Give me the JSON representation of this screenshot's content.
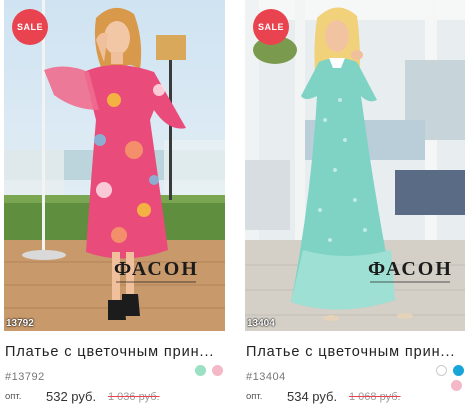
{
  "products": [
    {
      "sale_badge": "SALE",
      "watermark": "ФАСОН",
      "photo_id": "13792",
      "title": "Платье с цветочным прин...",
      "article": "#13792",
      "price_label": "опт.",
      "price": "532 руб.",
      "old_price": "1 036 руб.",
      "colors": [
        "#9be0c4",
        "#f4b8c8"
      ]
    },
    {
      "sale_badge": "SALE",
      "watermark": "ФАСОН",
      "photo_id": "13404",
      "title": "Платье с цветочным прин...",
      "article": "#13404",
      "price_label": "опт.",
      "price": "534 руб.",
      "old_price": "1 068 руб.",
      "colors": [
        "#ffffff",
        "#1aa5d8",
        "#f4b8c8"
      ]
    }
  ]
}
